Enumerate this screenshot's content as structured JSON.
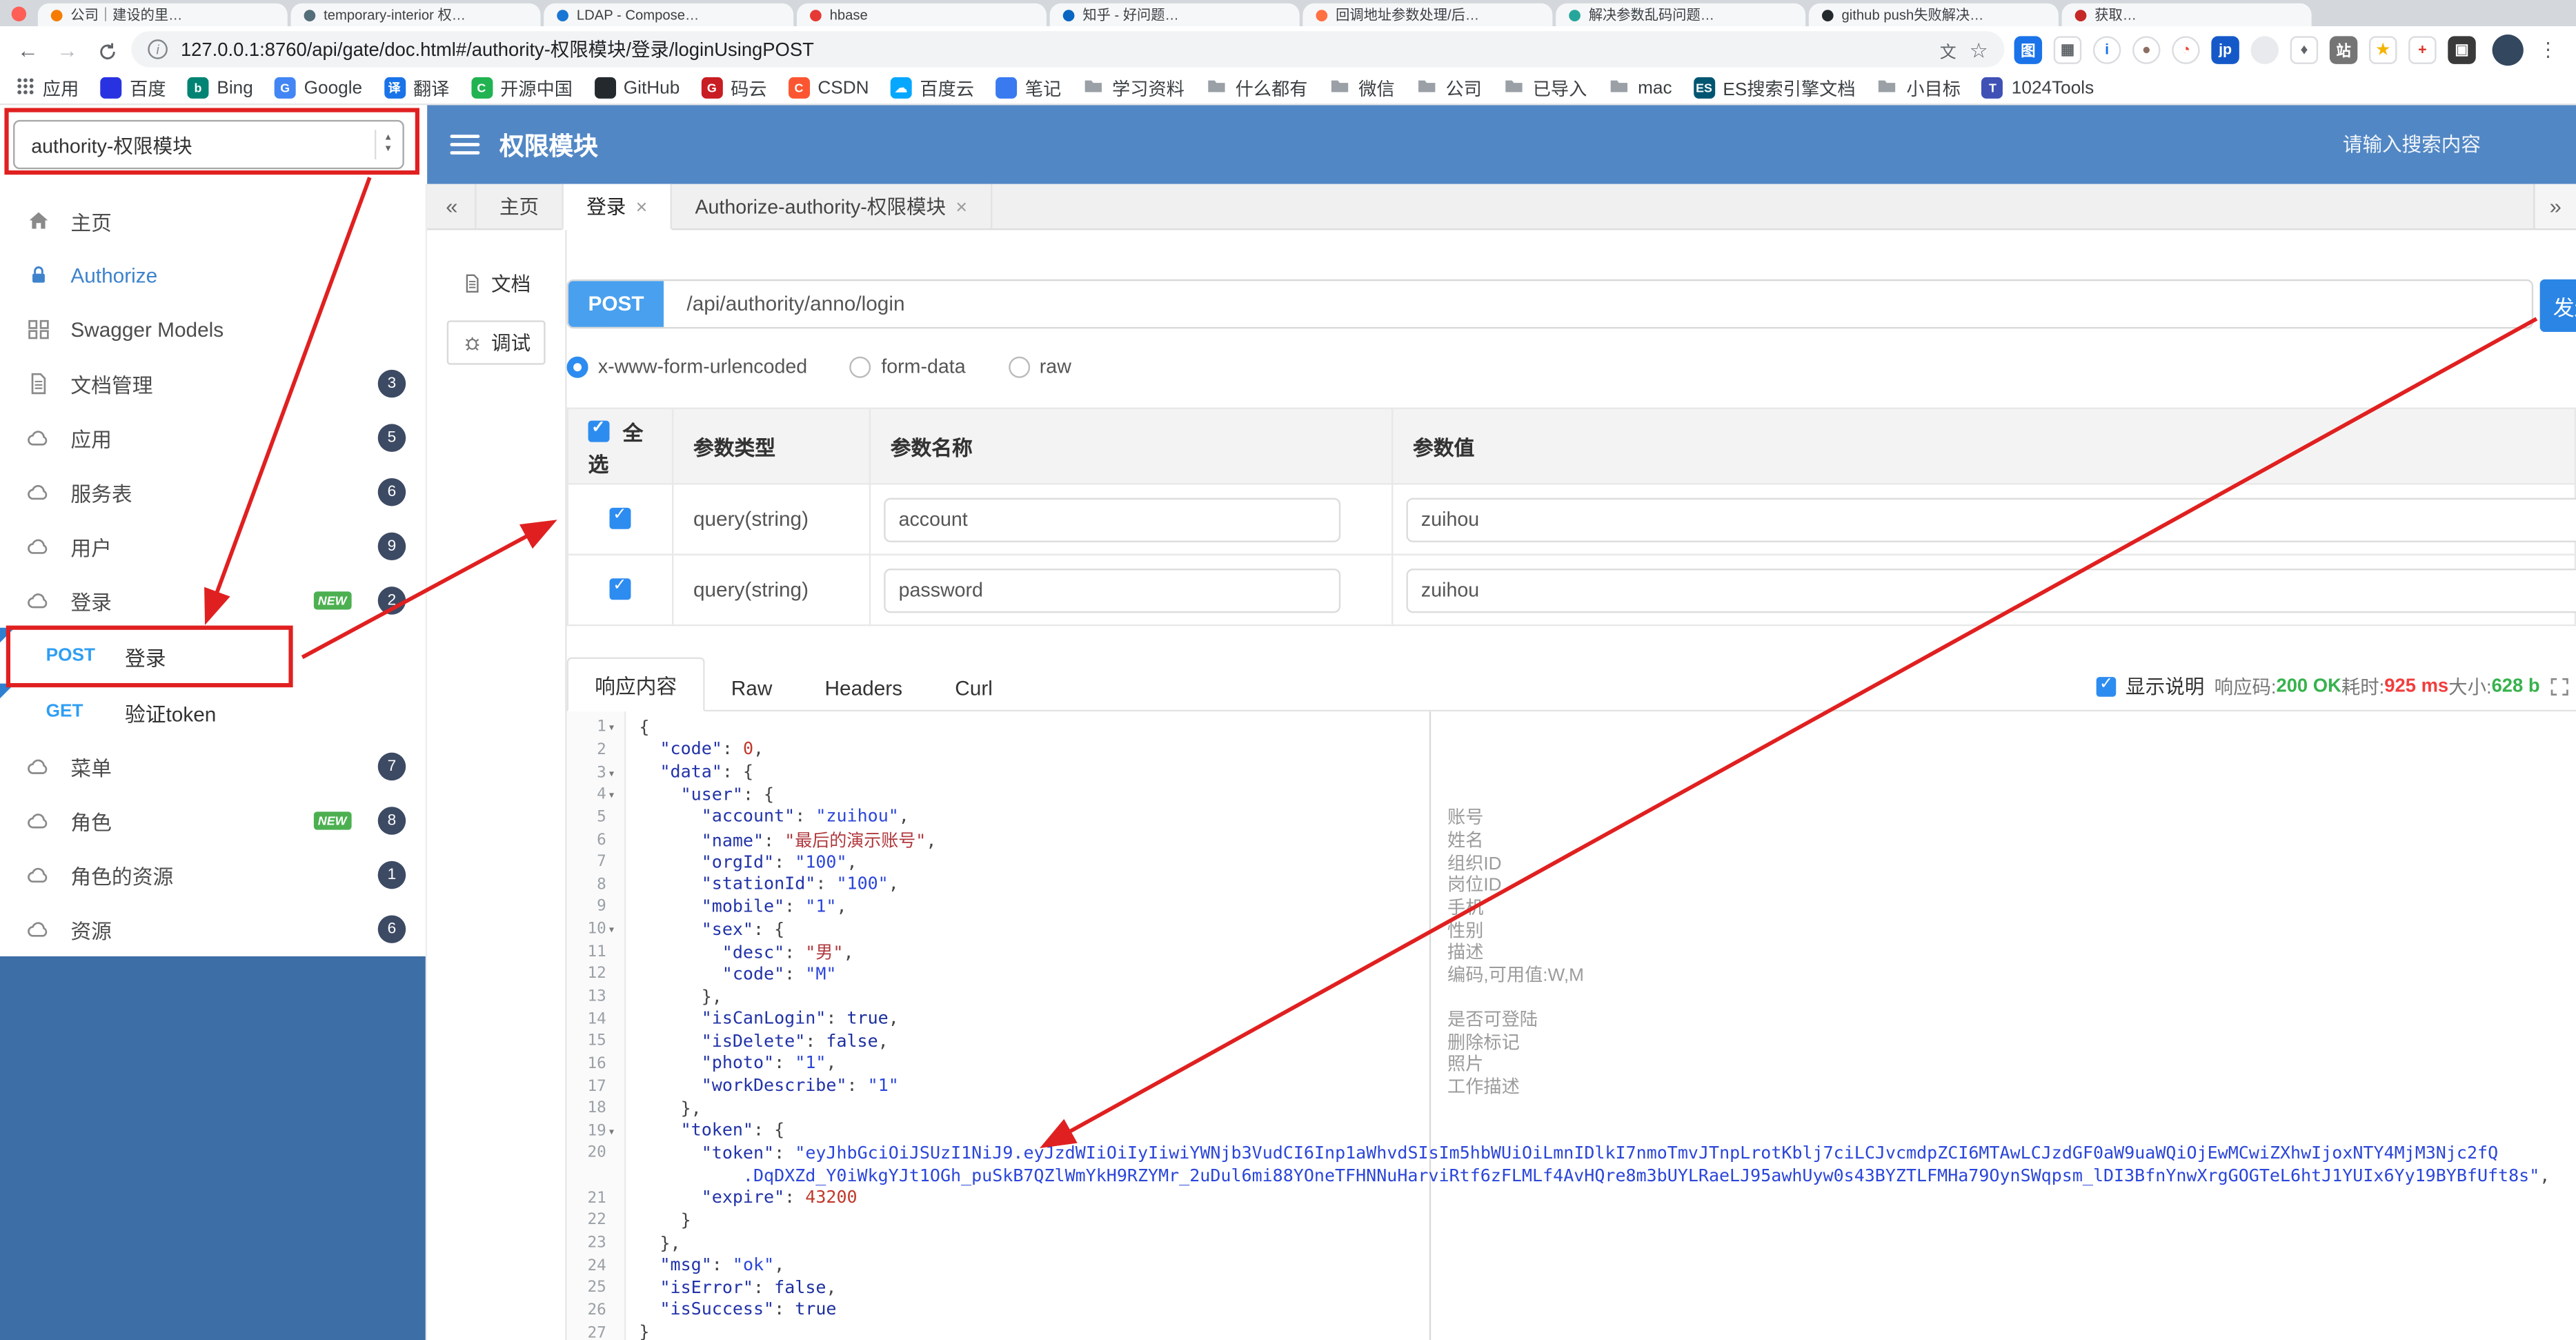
{
  "glyphs": {
    "back": "←",
    "forward": "→",
    "tabs_prev": "«",
    "tabs_next": "»",
    "tab_close": "×",
    "menu_kebab": "⋮",
    "bookmark_star": "☆",
    "stepper_up": "▲",
    "stepper_down": "▼",
    "fold_caret": "▾",
    "info": "i",
    "translate": "文"
  },
  "browser": {
    "tabs": [
      {
        "title": "公司｜建设的里…"
      },
      {
        "title": "temporary-interior 权…"
      },
      {
        "title": "LDAP - Compose…"
      },
      {
        "title": "hbase"
      },
      {
        "title": "知乎 - 好问题…"
      },
      {
        "title": "回调地址参数处理/后…"
      },
      {
        "title": "解决参数乱码问题…"
      },
      {
        "title": "github push失败解决…"
      },
      {
        "title": "获取…"
      }
    ],
    "address": {
      "url": "127.0.0.1:8760/api/gate/doc.html#/authority-权限模块/登录/loginUsingPOST"
    },
    "bookmarks_label": "应用",
    "bookmarks": [
      {
        "label": "百度",
        "kind": "site",
        "color": "#2932e1",
        "glyph": ""
      },
      {
        "label": "Bing",
        "kind": "site",
        "color": "#008373",
        "glyph": "b"
      },
      {
        "label": "Google",
        "kind": "site",
        "color": "#4285f4",
        "glyph": "G"
      },
      {
        "label": "翻译",
        "kind": "site",
        "color": "#1a73e8",
        "glyph": "译"
      },
      {
        "label": "开源中国",
        "kind": "site",
        "color": "#21b351",
        "glyph": "C"
      },
      {
        "label": "GitHub",
        "kind": "site",
        "color": "#24292e",
        "glyph": ""
      },
      {
        "label": "码云",
        "kind": "site",
        "color": "#c71d23",
        "glyph": "G"
      },
      {
        "label": "CSDN",
        "kind": "site",
        "color": "#fc5531",
        "glyph": "C"
      },
      {
        "label": "百度云",
        "kind": "site",
        "color": "#06a7ff",
        "glyph": "☁"
      },
      {
        "label": "笔记",
        "kind": "site",
        "color": "#3a7af0",
        "glyph": ""
      },
      {
        "label": "学习资料",
        "kind": "folder"
      },
      {
        "label": "什么都有",
        "kind": "folder"
      },
      {
        "label": "微信",
        "kind": "folder"
      },
      {
        "label": "公司",
        "kind": "folder"
      },
      {
        "label": "已导入",
        "kind": "folder"
      },
      {
        "label": "mac",
        "kind": "folder"
      },
      {
        "label": "ES搜索引擎文档",
        "kind": "site",
        "color": "#005571",
        "glyph": "ES"
      },
      {
        "label": "小目标",
        "kind": "folder"
      },
      {
        "label": "1024Tools",
        "kind": "site",
        "color": "#3f51b5",
        "glyph": "T"
      }
    ]
  },
  "header": {
    "service_selected": "authority-权限模块",
    "title": "权限模块",
    "search_placeholder": "请输入搜索内容"
  },
  "sidebar": {
    "new_badge_label": "NEW",
    "items": [
      {
        "label": "主页",
        "icon": "home-icon"
      },
      {
        "label": "Authorize",
        "icon": "lock-icon",
        "active": true
      },
      {
        "label": "Swagger Models",
        "icon": "models-icon"
      },
      {
        "label": "文档管理",
        "icon": "doc-icon",
        "badge": "3"
      },
      {
        "label": "应用",
        "icon": "cloud-icon",
        "badge": "5"
      },
      {
        "label": "服务表",
        "icon": "cloud-icon",
        "badge": "6"
      },
      {
        "label": "用户",
        "icon": "cloud-icon",
        "badge": "9"
      },
      {
        "label": "登录",
        "icon": "cloud-icon",
        "badge": "2",
        "new": true
      },
      {
        "method": "POST",
        "label": "登录",
        "selected": true
      },
      {
        "method": "GET",
        "label": "验证token"
      },
      {
        "label": "菜单",
        "icon": "cloud-icon",
        "badge": "7"
      },
      {
        "label": "角色",
        "icon": "cloud-icon",
        "badge": "8",
        "new": true
      },
      {
        "label": "角色的资源",
        "icon": "cloud-icon",
        "badge": "1"
      },
      {
        "label": "资源",
        "icon": "cloud-icon",
        "badge": "6"
      }
    ]
  },
  "content_tabs": {
    "items": [
      {
        "label": "主页"
      },
      {
        "label": "登录",
        "closable": true,
        "active": true
      },
      {
        "label": "Authorize-authority-权限模块",
        "closable": true
      }
    ]
  },
  "side_tabs": {
    "items": [
      {
        "label": "文档",
        "icon": "doc-icon"
      },
      {
        "label": "调试",
        "icon": "debug-icon",
        "active": true
      }
    ]
  },
  "request": {
    "method": "POST",
    "path": "/api/authority/anno/login",
    "send_label": "发送",
    "body_types": [
      {
        "label": "x-www-form-urlencoded",
        "selected": true
      },
      {
        "label": "form-data",
        "selected": false
      },
      {
        "label": "raw",
        "selected": false
      }
    ]
  },
  "params": {
    "headers": [
      "全选",
      "参数类型",
      "参数名称",
      "参数值"
    ],
    "rows": [
      {
        "checked": true,
        "type": "query(string)",
        "name": "account",
        "value": "zuihou"
      },
      {
        "checked": true,
        "type": "query(string)",
        "name": "password",
        "value": "zuihou"
      }
    ]
  },
  "response": {
    "tabs": [
      {
        "label": "响应内容",
        "active": true
      },
      {
        "label": "Raw"
      },
      {
        "label": "Headers"
      },
      {
        "label": "Curl"
      }
    ],
    "show_desc_label": "显示说明",
    "show_desc_checked": true,
    "meta": [
      {
        "label": "响应码:",
        "value": "200 OK",
        "color": "#37b24d"
      },
      {
        "label": "耗时:",
        "value": "925 ms",
        "color": "#f03e3e"
      },
      {
        "label": "大小:",
        "value": "628 b",
        "color": "#37b24d"
      }
    ]
  },
  "code": {
    "lines": [
      {
        "num": "1",
        "fold": true,
        "segs": [
          [
            "p",
            "{"
          ]
        ]
      },
      {
        "num": "2",
        "segs": [
          [
            "p",
            "  "
          ],
          [
            "k",
            "\"code\""
          ],
          [
            "p",
            ": "
          ],
          [
            "d",
            "0"
          ],
          [
            "p",
            ","
          ]
        ]
      },
      {
        "num": "3",
        "fold": true,
        "segs": [
          [
            "p",
            "  "
          ],
          [
            "k",
            "\"data\""
          ],
          [
            "p",
            ": {"
          ]
        ]
      },
      {
        "num": "4",
        "fold": true,
        "segs": [
          [
            "p",
            "    "
          ],
          [
            "k",
            "\"user\""
          ],
          [
            "p",
            ": {"
          ]
        ]
      },
      {
        "num": "5",
        "ann": "账号",
        "segs": [
          [
            "p",
            "      "
          ],
          [
            "k",
            "\"account\""
          ],
          [
            "p",
            ": "
          ],
          [
            "s",
            "\"zuihou\""
          ],
          [
            "p",
            ","
          ]
        ]
      },
      {
        "num": "6",
        "ann": "姓名",
        "segs": [
          [
            "p",
            "      "
          ],
          [
            "k",
            "\"name\""
          ],
          [
            "p",
            ": "
          ],
          [
            "c",
            "\"最后的演示账号\""
          ],
          [
            "p",
            ","
          ]
        ]
      },
      {
        "num": "7",
        "ann": "组织ID",
        "segs": [
          [
            "p",
            "      "
          ],
          [
            "k",
            "\"orgId\""
          ],
          [
            "p",
            ": "
          ],
          [
            "s",
            "\"100\""
          ],
          [
            "p",
            ","
          ]
        ]
      },
      {
        "num": "8",
        "ann": "岗位ID",
        "segs": [
          [
            "p",
            "      "
          ],
          [
            "k",
            "\"stationId\""
          ],
          [
            "p",
            ": "
          ],
          [
            "s",
            "\"100\""
          ],
          [
            "p",
            ","
          ]
        ]
      },
      {
        "num": "9",
        "ann": "手机",
        "segs": [
          [
            "p",
            "      "
          ],
          [
            "k",
            "\"mobile\""
          ],
          [
            "p",
            ": "
          ],
          [
            "s",
            "\"1\""
          ],
          [
            "p",
            ","
          ]
        ]
      },
      {
        "num": "10",
        "fold": true,
        "ann": "性别",
        "segs": [
          [
            "p",
            "      "
          ],
          [
            "k",
            "\"sex\""
          ],
          [
            "p",
            ": {"
          ]
        ]
      },
      {
        "num": "11",
        "ann": "描述",
        "segs": [
          [
            "p",
            "        "
          ],
          [
            "k",
            "\"desc\""
          ],
          [
            "p",
            ": "
          ],
          [
            "c",
            "\"男\""
          ],
          [
            "p",
            ","
          ]
        ]
      },
      {
        "num": "12",
        "ann": "编码,可用值:W,M",
        "segs": [
          [
            "p",
            "        "
          ],
          [
            "k",
            "\"code\""
          ],
          [
            "p",
            ": "
          ],
          [
            "s",
            "\"M\""
          ]
        ]
      },
      {
        "num": "13",
        "segs": [
          [
            "p",
            "      },"
          ]
        ]
      },
      {
        "num": "14",
        "ann": "是否可登陆",
        "segs": [
          [
            "p",
            "      "
          ],
          [
            "k",
            "\"isCanLogin\""
          ],
          [
            "p",
            ": "
          ],
          [
            "b",
            "true"
          ],
          [
            "p",
            ","
          ]
        ]
      },
      {
        "num": "15",
        "ann": "删除标记",
        "segs": [
          [
            "p",
            "      "
          ],
          [
            "k",
            "\"isDelete\""
          ],
          [
            "p",
            ": "
          ],
          [
            "b",
            "false"
          ],
          [
            "p",
            ","
          ]
        ]
      },
      {
        "num": "16",
        "ann": "照片",
        "segs": [
          [
            "p",
            "      "
          ],
          [
            "k",
            "\"photo\""
          ],
          [
            "p",
            ": "
          ],
          [
            "s",
            "\"1\""
          ],
          [
            "p",
            ","
          ]
        ]
      },
      {
        "num": "17",
        "ann": "工作描述",
        "segs": [
          [
            "p",
            "      "
          ],
          [
            "k",
            "\"workDescribe\""
          ],
          [
            "p",
            ": "
          ],
          [
            "s",
            "\"1\""
          ]
        ]
      },
      {
        "num": "18",
        "segs": [
          [
            "p",
            "    },"
          ]
        ]
      },
      {
        "num": "19",
        "fold": true,
        "segs": [
          [
            "p",
            "    "
          ],
          [
            "k",
            "\"token\""
          ],
          [
            "p",
            ": {"
          ]
        ]
      },
      {
        "num": "20",
        "segs": [
          [
            "p",
            "      "
          ],
          [
            "k",
            "\"token\""
          ],
          [
            "p",
            ": "
          ],
          [
            "s",
            "\"eyJhbGciOiJSUzI1NiJ9.eyJzdWIiOiIyIiwiYWNjb3VudCI6Inp1aWhvdSIsIm5hbWUiOiLmnIDlkI7nmoTmvJTnpLrotKblj7ciLCJvcmdpZCI6MTAwLCJzdGF0aW9uaWQiOjEwMCwiZXhwIjoxNTY4MjM3Njc2fQ"
          ]
        ]
      },
      {
        "num": "",
        "segs": [
          [
            "p",
            "          "
          ],
          [
            "s",
            ".DqDXZd_Y0iWkgYJt1OGh_puSkB7QZlWmYkH9RZYMr_2uDul6mi88YOneTFHNNuHarviRtf6zFLMLf4AvHQre8m3bUYLRaeLJ95awhUyw0s43BYZTLFMHa79OynSWqpsm_lDI3BfnYnwXrgGOGTeL6htJ1YUIx6Yy19BYBfUft8s\""
          ],
          [
            "p",
            ","
          ]
        ]
      },
      {
        "num": "21",
        "segs": [
          [
            "p",
            "      "
          ],
          [
            "k",
            "\"expire\""
          ],
          [
            "p",
            ": "
          ],
          [
            "d",
            "43200"
          ]
        ]
      },
      {
        "num": "22",
        "segs": [
          [
            "p",
            "    }"
          ]
        ]
      },
      {
        "num": "23",
        "segs": [
          [
            "p",
            "  },"
          ]
        ]
      },
      {
        "num": "24",
        "segs": [
          [
            "p",
            "  "
          ],
          [
            "k",
            "\"msg\""
          ],
          [
            "p",
            ": "
          ],
          [
            "s",
            "\"ok\""
          ],
          [
            "p",
            ","
          ]
        ]
      },
      {
        "num": "25",
        "segs": [
          [
            "p",
            "  "
          ],
          [
            "k",
            "\"isError\""
          ],
          [
            "p",
            ": "
          ],
          [
            "b",
            "false"
          ],
          [
            "p",
            ","
          ]
        ]
      },
      {
        "num": "26",
        "segs": [
          [
            "p",
            "  "
          ],
          [
            "k",
            "\"isSuccess\""
          ],
          [
            "p",
            ": "
          ],
          [
            "b",
            "true"
          ]
        ]
      },
      {
        "num": "27",
        "segs": [
          [
            "p",
            "}"
          ]
        ]
      }
    ]
  },
  "colors": {
    "header_blue": "#5287c5",
    "sidebar_blue": "#3d6ea6",
    "accent_blue": "#2d8cf0",
    "annotation_red": "#e02020",
    "badge_dark": "#3d4a63",
    "new_green": "#4cb050"
  }
}
